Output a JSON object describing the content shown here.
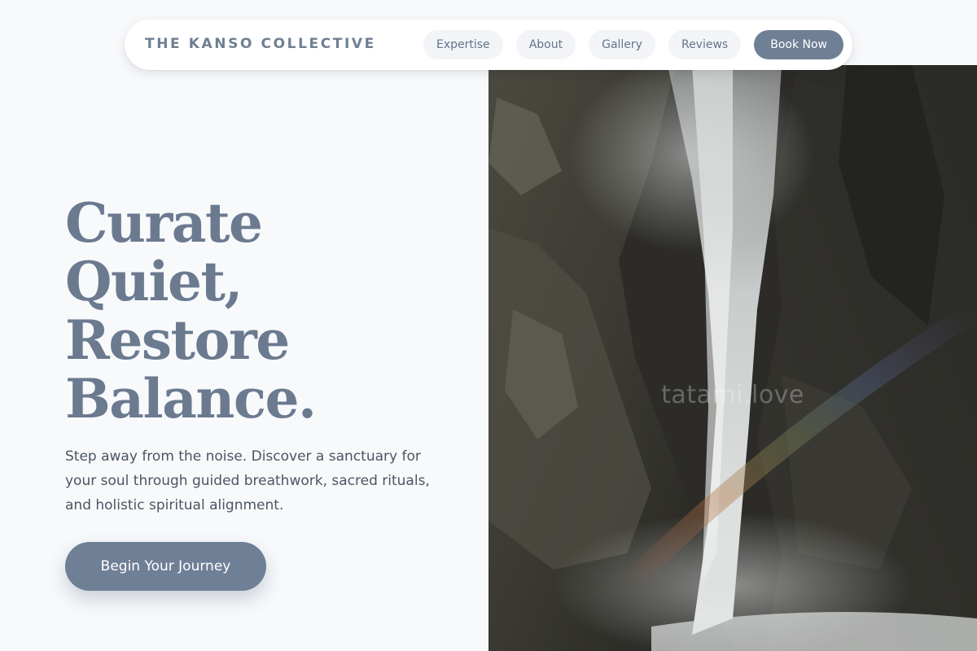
{
  "nav": {
    "brand": "THE KANSO COLLECTIVE",
    "links": [
      "Expertise",
      "About",
      "Gallery",
      "Reviews"
    ],
    "cta": "Book Now"
  },
  "hero": {
    "headline": [
      "Curate",
      "Quiet,",
      "Restore",
      "Balance."
    ],
    "subcopy": "Step away from the noise. Discover a sanctuary for your soul through guided breathwork, sacred rituals, and holistic spiritual alignment.",
    "cta": "Begin Your Journey",
    "image_watermark": "tatami.love"
  },
  "colors": {
    "background": "#f7f9fb",
    "accent": "#6f7f96",
    "headline": "#6b7a8f",
    "body_text": "#4b5563"
  }
}
